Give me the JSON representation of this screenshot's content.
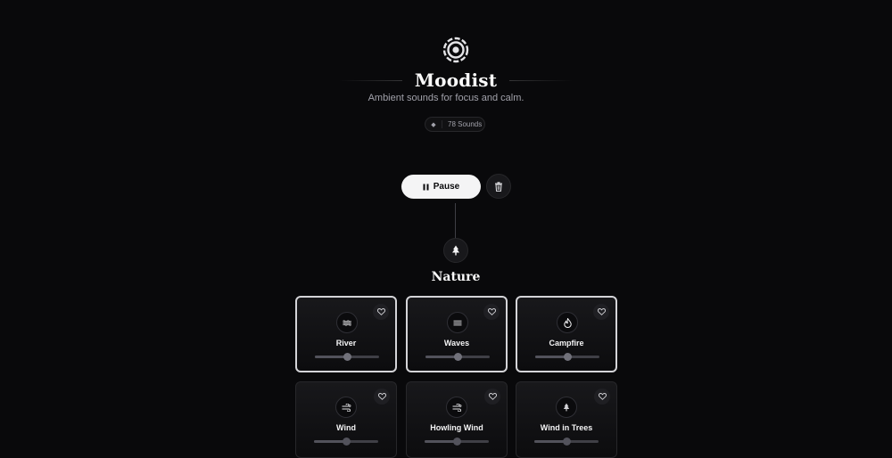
{
  "header": {
    "logo_icon": "moodist-logo-icon",
    "title": "Moodist",
    "subtitle": "Ambient sounds for focus and calm.",
    "sounds_badge": {
      "icon": "sound-wave-icon",
      "label": "78 Sounds"
    }
  },
  "controls": {
    "pause_label": "Pause",
    "pause_icon": "pause-icon",
    "delete_icon": "trash-icon"
  },
  "category": {
    "icon": "tree-icon",
    "title": "Nature",
    "sounds": [
      {
        "name": "River",
        "icon": "water-icon",
        "selected": true,
        "volume": 0.5,
        "favorite": false
      },
      {
        "name": "Waves",
        "icon": "waves-icon",
        "selected": true,
        "volume": 0.5,
        "favorite": false
      },
      {
        "name": "Campfire",
        "icon": "fire-icon",
        "selected": true,
        "volume": 0.5,
        "favorite": false
      },
      {
        "name": "Wind",
        "icon": "wind-icon",
        "selected": false,
        "volume": 0.5,
        "favorite": false
      },
      {
        "name": "Howling Wind",
        "icon": "wind-icon",
        "selected": false,
        "volume": 0.5,
        "favorite": false
      },
      {
        "name": "Wind in Trees",
        "icon": "tree-icon",
        "selected": false,
        "volume": 0.5,
        "favorite": false
      }
    ]
  },
  "colors": {
    "background": "#09090b",
    "accent": "#fafafa",
    "muted": "#a1a1aa",
    "border": "#27272a"
  }
}
